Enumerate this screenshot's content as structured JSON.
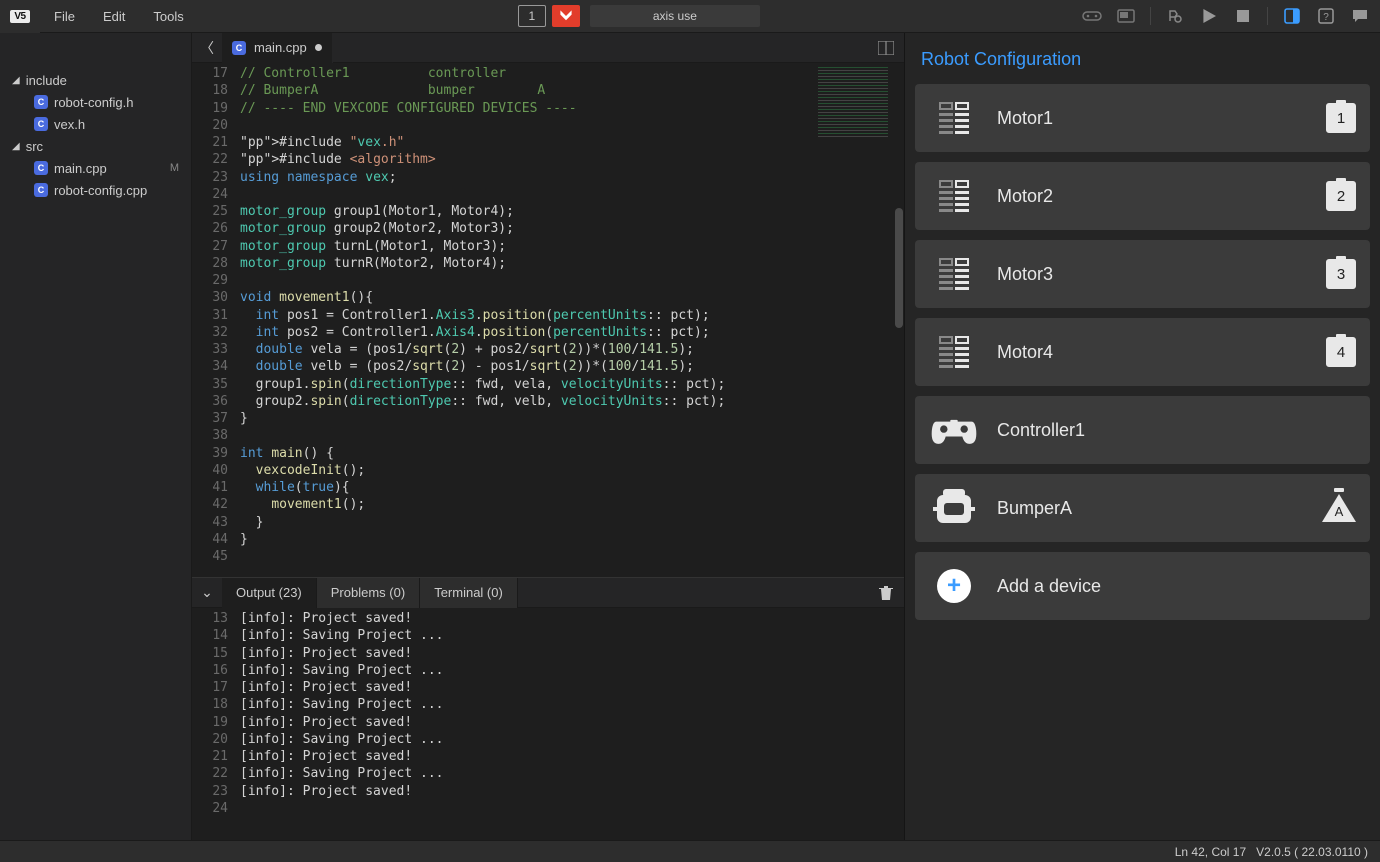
{
  "menubar": {
    "logo": "V5",
    "items": [
      "File",
      "Edit",
      "Tools"
    ],
    "slot_number": "1",
    "project_name": "axis use"
  },
  "sidebar": {
    "folders": [
      {
        "name": "include",
        "files": [
          "robot-config.h",
          "vex.h"
        ]
      },
      {
        "name": "src",
        "files": [
          "main.cpp",
          "robot-config.cpp"
        ],
        "modified": [
          "main.cpp"
        ]
      }
    ]
  },
  "tabs": {
    "active": "main.cpp"
  },
  "editor": {
    "first_line": 17,
    "lines": [
      "// Controller1          controller",
      "// BumperA              bumper        A",
      "// ---- END VEXCODE CONFIGURED DEVICES ----",
      "",
      "#include \"vex.h\"",
      "#include <algorithm>",
      "using namespace vex;",
      "",
      "motor_group group1(Motor1, Motor4);",
      "motor_group group2(Motor2, Motor3);",
      "motor_group turnL(Motor1, Motor3);",
      "motor_group turnR(Motor2, Motor4);",
      "",
      "void movement1(){",
      "  int pos1 = Controller1.Axis3.position(percentUnits:: pct);",
      "  int pos2 = Controller1.Axis4.position(percentUnits:: pct);",
      "  double vela = (pos1/sqrt(2) + pos2/sqrt(2))*(100/141.5);",
      "  double velb = (pos2/sqrt(2) - pos1/sqrt(2))*(100/141.5);",
      "  group1.spin(directionType:: fwd, vela, velocityUnits:: pct);",
      "  group2.spin(directionType:: fwd, velb, velocityUnits:: pct);",
      "}",
      "",
      "int main() {",
      "  vexcodeInit();",
      "  while(true){",
      "    movement1();",
      "  }",
      "}",
      ""
    ]
  },
  "output": {
    "tabs": {
      "output": "Output (23)",
      "problems": "Problems (0)",
      "terminal": "Terminal (0)"
    },
    "first_line": 13,
    "lines": [
      "[info]: Project saved!",
      "[info]: Saving Project ...",
      "[info]: Project saved!",
      "[info]: Saving Project ...",
      "[info]: Project saved!",
      "[info]: Saving Project ...",
      "[info]: Project saved!",
      "[info]: Saving Project ...",
      "[info]: Project saved!",
      "[info]: Saving Project ...",
      "[info]: Project saved!",
      ""
    ]
  },
  "config": {
    "title": "Robot Configuration",
    "devices": [
      {
        "name": "Motor1",
        "icon": "motor",
        "port": "1"
      },
      {
        "name": "Motor2",
        "icon": "motor",
        "port": "2"
      },
      {
        "name": "Motor3",
        "icon": "motor",
        "port": "3"
      },
      {
        "name": "Motor4",
        "icon": "motor",
        "port": "4"
      },
      {
        "name": "Controller1",
        "icon": "controller",
        "port": ""
      },
      {
        "name": "BumperA",
        "icon": "bumper",
        "port": "A",
        "tri": true
      }
    ],
    "add_label": "Add a device"
  },
  "statusbar": {
    "pos": "Ln 42, Col 17",
    "version": "V2.0.5 ( 22.03.0110 )"
  }
}
